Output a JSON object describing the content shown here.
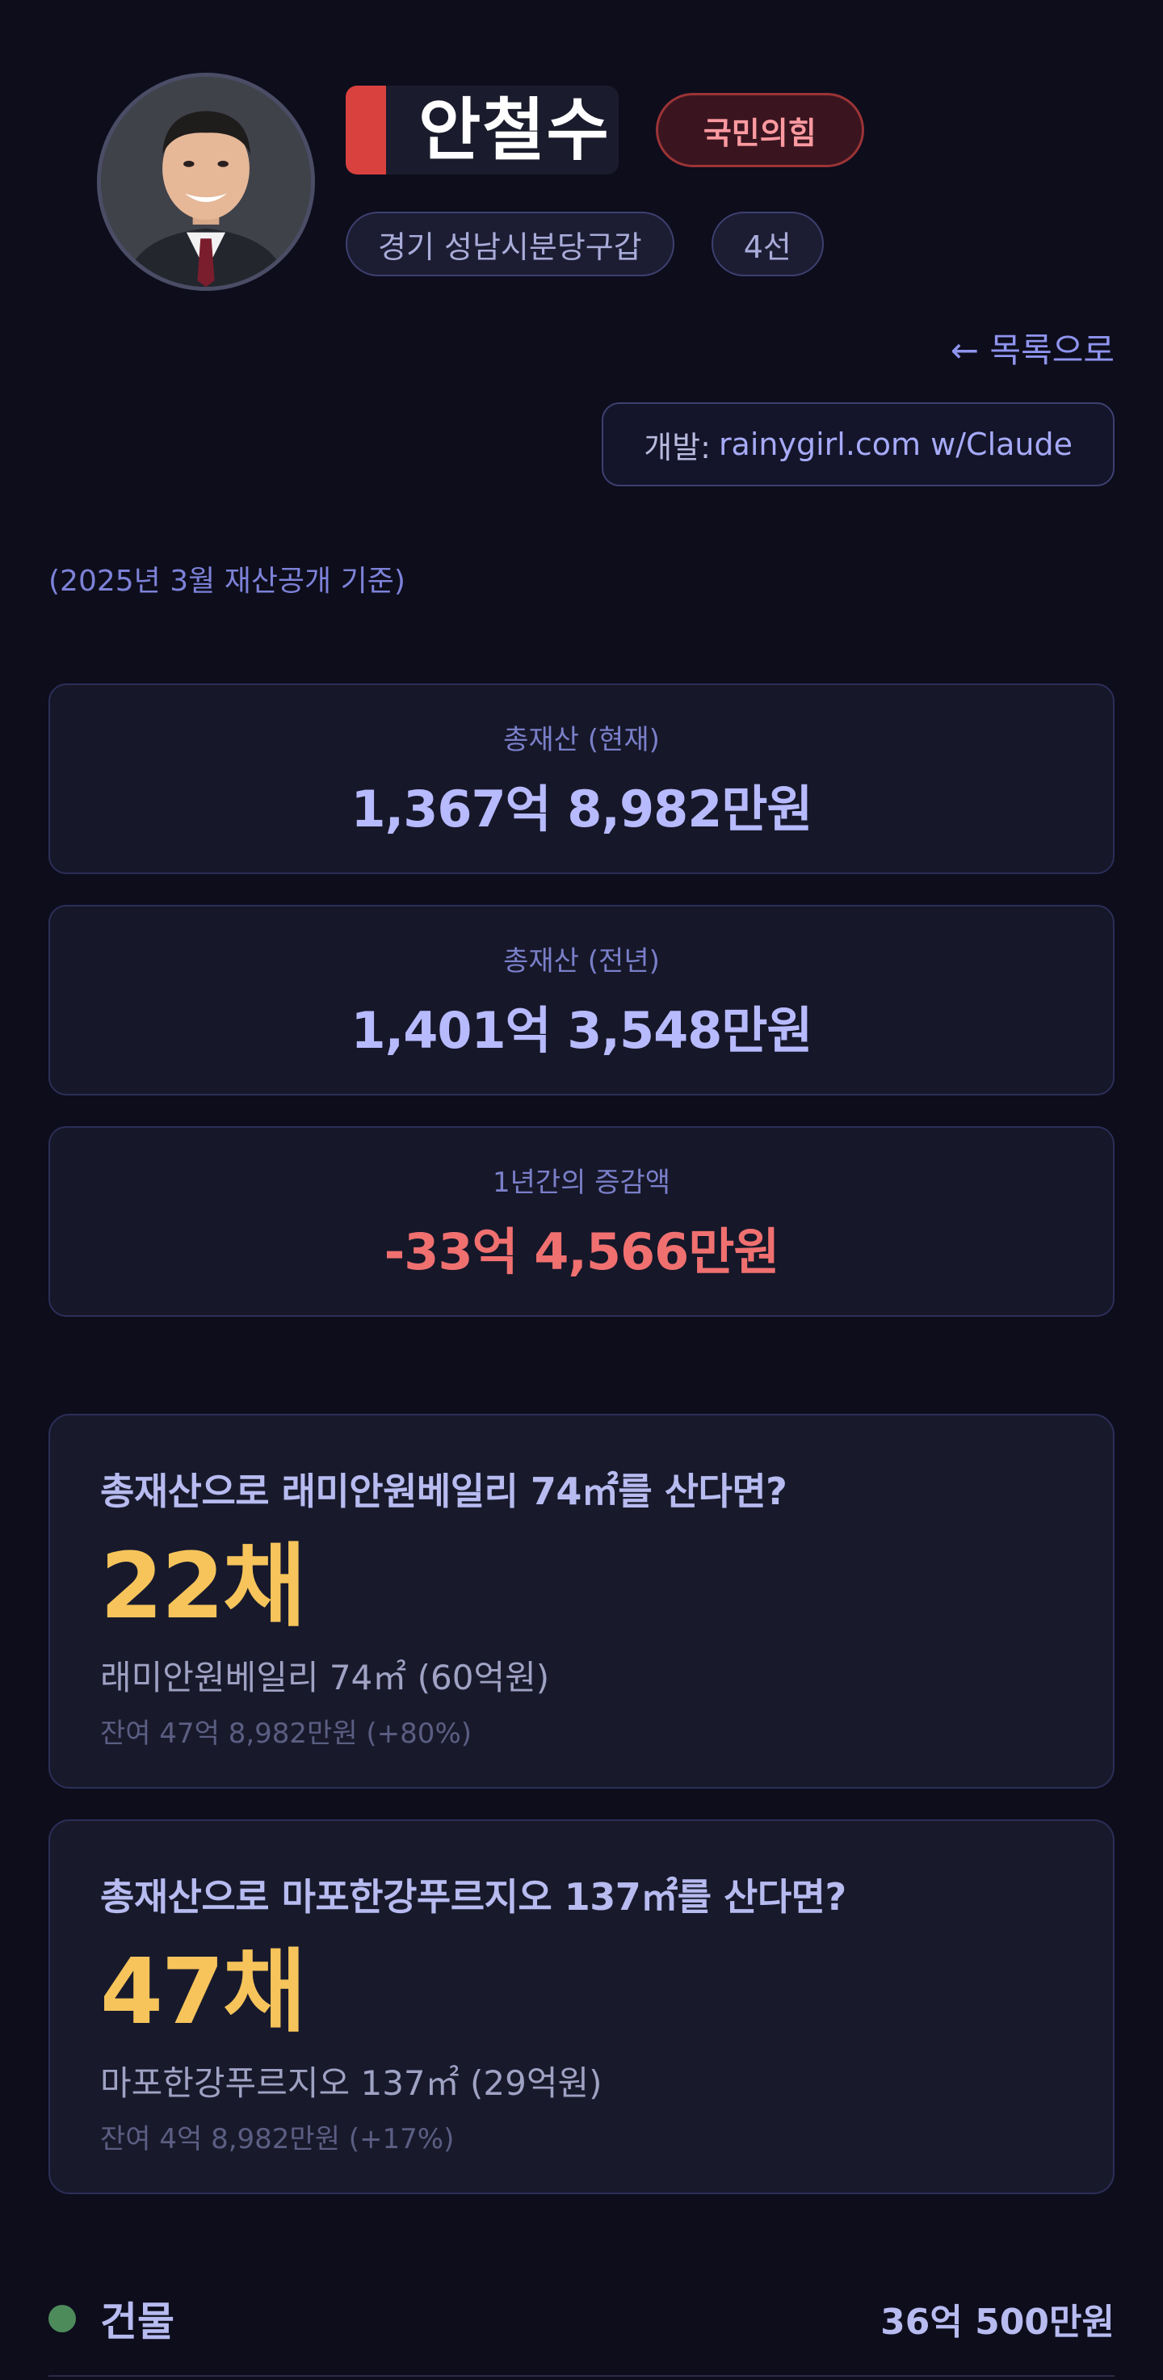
{
  "profile": {
    "name": "안철수",
    "party": "국민의힘",
    "district": "경기 성남시분당구갑",
    "terms": "4선",
    "party_color": "#d9413e"
  },
  "nav": {
    "back_label": "← 목록으로",
    "credit_prefix": "개발:",
    "credit_link": "rainygirl.com w/Claude"
  },
  "note": "(2025년 3월 재산공개 기준)",
  "stats": [
    {
      "label": "총재산 (현재)",
      "value": "1,367억 8,982만원",
      "tone": "neutral"
    },
    {
      "label": "총재산 (전년)",
      "value": "1,401억 3,548만원",
      "tone": "neutral"
    },
    {
      "label": "1년간의 증감액",
      "value": "-33억 4,566만원",
      "tone": "negative"
    }
  ],
  "purchases": [
    {
      "question": "총재산으로 래미안원베일리 74㎡를 산다면?",
      "count": "22채",
      "price": "래미안원베일리 74㎡ (60억원)",
      "remainder": "잔여 47억 8,982만원 (+80%)"
    },
    {
      "question": "총재산으로 마포한강푸르지오 137㎡를 산다면?",
      "count": "47채",
      "price": "마포한강푸르지오 137㎡ (29억원)",
      "remainder": "잔여 4억 8,982만원 (+17%)"
    }
  ],
  "assets": [
    {
      "label": "건물",
      "value": "36억 500만원",
      "color": "#4d8b5b"
    }
  ]
}
